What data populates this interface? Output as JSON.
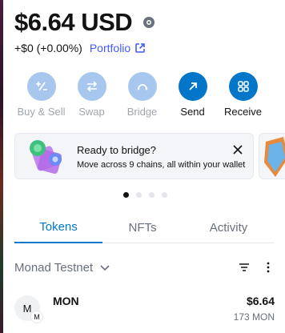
{
  "balance": {
    "amount": "$6.64 USD"
  },
  "change": {
    "text": "+$0 (+0.00%)",
    "portfolio_label": "Portfolio"
  },
  "actions": [
    {
      "label": "Buy & Sell",
      "icon": "plus-minus-icon",
      "enabled": false
    },
    {
      "label": "Swap",
      "icon": "swap-arrows-icon",
      "enabled": false
    },
    {
      "label": "Bridge",
      "icon": "bridge-icon",
      "enabled": false
    },
    {
      "label": "Send",
      "icon": "arrow-up-right-icon",
      "enabled": true
    },
    {
      "label": "Receive",
      "icon": "qr-code-icon",
      "enabled": true
    }
  ],
  "banner": {
    "title": "Ready to bridge?",
    "description": "Move across 9 chains, all within your wallet"
  },
  "carousel": {
    "total": 4,
    "active": 1
  },
  "tabs": [
    {
      "label": "Tokens",
      "active": true
    },
    {
      "label": "NFTs",
      "active": false
    },
    {
      "label": "Activity",
      "active": false
    }
  ],
  "network": {
    "name": "Monad Testnet"
  },
  "tokens": [
    {
      "avatar_letter": "M",
      "badge_letter": "M",
      "symbol": "MON",
      "fiat": "$6.64",
      "amount": "173 MON"
    }
  ],
  "colors": {
    "accent": "#0376c9",
    "link": "#4459ff",
    "disabled": "#a8c7ee",
    "text": "#121314",
    "muted": "#686e7d"
  }
}
